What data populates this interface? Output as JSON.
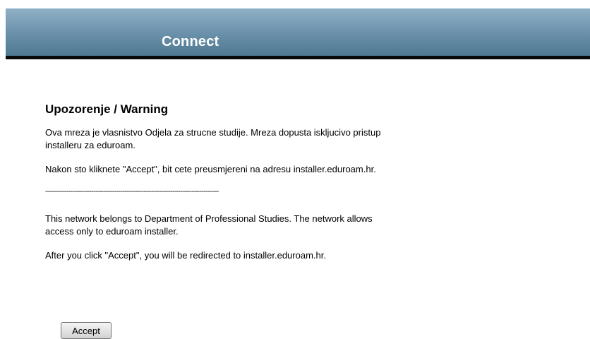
{
  "header": {
    "title": "Connect",
    "gradient_top": "#8fb1c6",
    "gradient_bottom": "#4f7891",
    "rule_color": "#0a0a0a"
  },
  "notice": {
    "heading": "Upozorenje / Warning",
    "para_hr_1": "Ova mreza je vlasnistvo Odjela za strucne studije. Mreza dopusta iskljucivo pristup installeru za eduroam.",
    "para_hr_2": "Nakon sto kliknete \"Accept\", bit cete preusmjereni na adresu installer.eduroam.hr.",
    "divider": "------------------------------------------------------------------------------------------",
    "para_en_1": "This network belongs to Department of Professional Studies. The network allows access only to eduroam installer.",
    "para_en_2": "After you click \"Accept\", you will be redirected to installer.eduroam.hr."
  },
  "actions": {
    "accept_label": "Accept"
  }
}
